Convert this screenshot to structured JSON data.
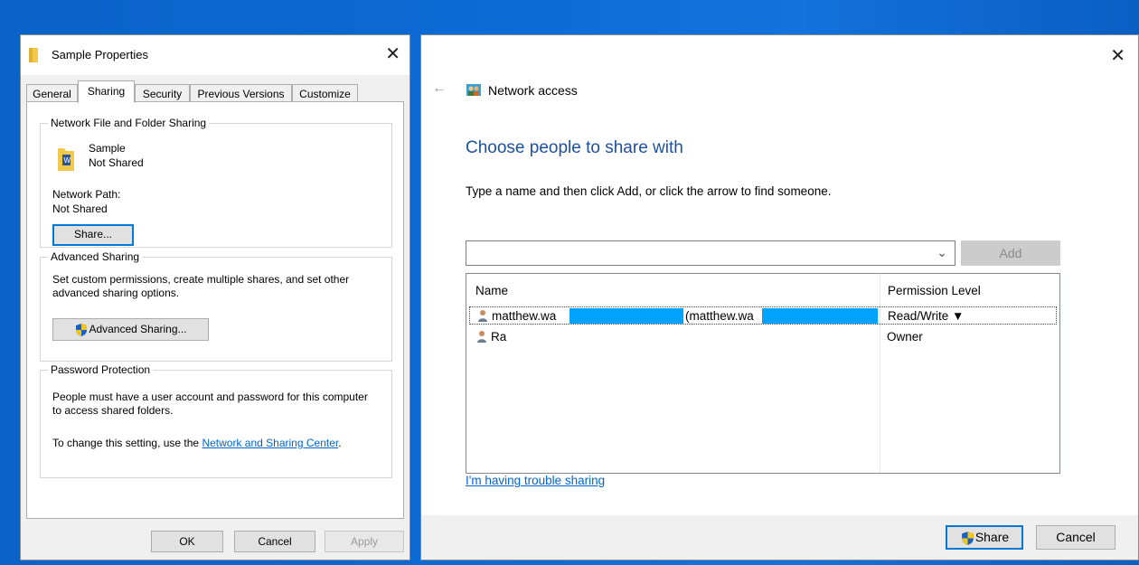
{
  "properties": {
    "title": "Sample Properties",
    "close": "✕",
    "tabs": [
      "General",
      "Sharing",
      "Security",
      "Previous Versions",
      "Customize"
    ],
    "active_tab": "Sharing",
    "network_sharing": {
      "group_title": "Network File and Folder Sharing",
      "item_name": "Sample",
      "item_status": "Not Shared",
      "path_label": "Network Path:",
      "path_value": "Not Shared",
      "share_button": "Share..."
    },
    "advanced_sharing": {
      "group_title": "Advanced Sharing",
      "description": "Set custom permissions, create multiple shares, and set other advanced sharing options.",
      "button": "Advanced Sharing..."
    },
    "password_protection": {
      "group_title": "Password Protection",
      "description": "People must have a user account and password for this computer to access shared folders.",
      "change_prefix": "To change this setting, use the ",
      "change_link": "Network and Sharing Center",
      "change_suffix": "."
    },
    "buttons": {
      "ok": "OK",
      "cancel": "Cancel",
      "apply": "Apply"
    }
  },
  "network_access": {
    "back": "←",
    "close": "✕",
    "title": "Network access",
    "heading": "Choose people to share with",
    "instruction": "Type a name and then click Add, or click the arrow to find someone.",
    "input_value": "",
    "add_button": "Add",
    "columns": {
      "name": "Name",
      "permission": "Permission Level"
    },
    "rows": [
      {
        "name_part1": "matthew.wa",
        "name_part2": "(matthew.wa",
        "permission": "Read/Write ▼"
      },
      {
        "name": "Ra",
        "permission": "Owner"
      }
    ],
    "trouble_link": "I'm having trouble sharing",
    "share_button": "Share",
    "cancel_button": "Cancel"
  },
  "colors": {
    "accent": "#0078d7",
    "heading": "#1e50a2",
    "link": "#0066cc",
    "redaction": "#00a2ff",
    "desktop": "#0c6ad4"
  },
  "icons": [
    "folder-icon",
    "document-folder-icon",
    "shield-icon",
    "network-users-icon",
    "user-icon",
    "chevron-down-icon",
    "close-icon",
    "back-arrow-icon"
  ]
}
